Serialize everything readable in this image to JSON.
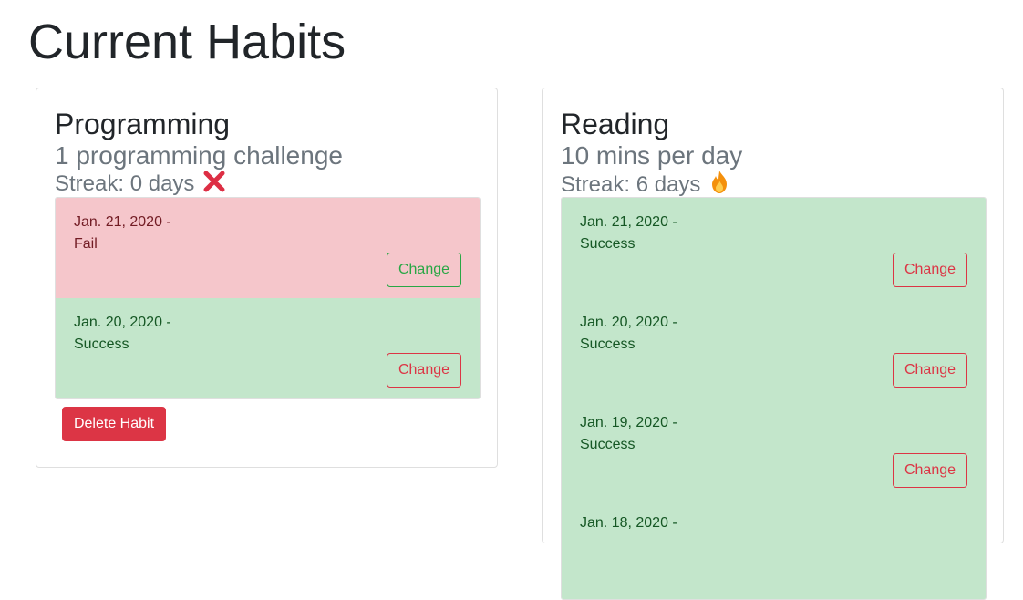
{
  "page": {
    "title": "Current Habits"
  },
  "habits": [
    {
      "name": "Programming",
      "goal": "1 programming challenge",
      "streak": "Streak: 0 days",
      "streak_icon": "cross-mark-icon",
      "delete_label": "Delete Habit",
      "entries": [
        {
          "date": "Jan. 21, 2020 -",
          "status": "Fail",
          "change_label": "Change"
        },
        {
          "date": "Jan. 20, 2020 -",
          "status": "Success",
          "change_label": "Change"
        }
      ]
    },
    {
      "name": "Reading",
      "goal": "10 mins per day",
      "streak": "Streak: 6 days",
      "streak_icon": "fire-icon",
      "entries": [
        {
          "date": "Jan. 21, 2020 -",
          "status": "Success",
          "change_label": "Change"
        },
        {
          "date": "Jan. 20, 2020 -",
          "status": "Success",
          "change_label": "Change"
        },
        {
          "date": "Jan. 19, 2020 -",
          "status": "Success",
          "change_label": "Change"
        },
        {
          "date": "Jan. 18, 2020 -",
          "status": "",
          "change_label": ""
        }
      ]
    }
  ],
  "colors": {
    "success_bg": "#c3e6cb",
    "success_text": "#155724",
    "fail_bg": "#f5c6cb",
    "fail_text": "#721c24",
    "danger": "#dc3545",
    "success": "#28a745"
  }
}
